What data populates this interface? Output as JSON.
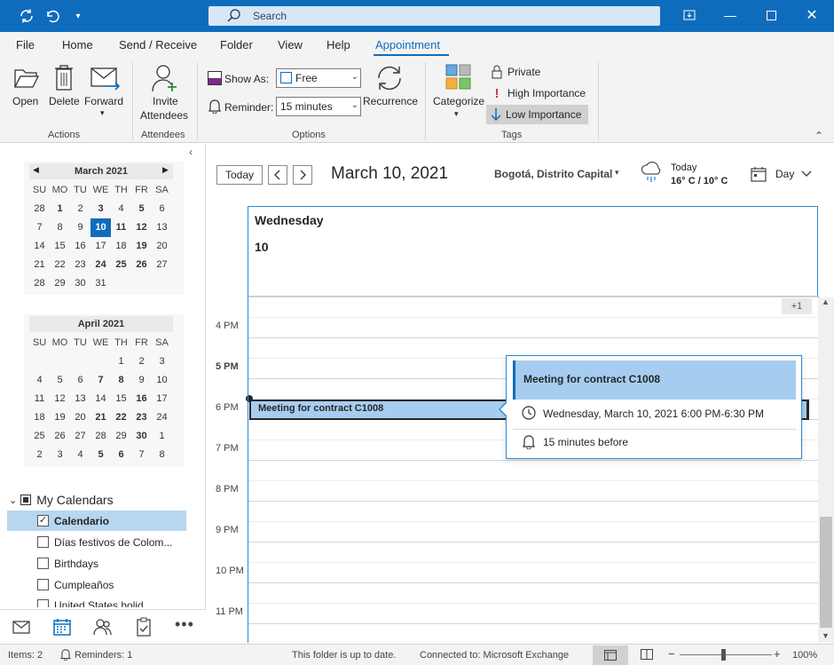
{
  "search": {
    "placeholder": "Search"
  },
  "menu": {
    "tabs": [
      {
        "label": "File"
      },
      {
        "label": "Home"
      },
      {
        "label": "Send / Receive"
      },
      {
        "label": "Folder"
      },
      {
        "label": "View"
      },
      {
        "label": "Help"
      },
      {
        "label": "Appointment",
        "active": true
      }
    ]
  },
  "ribbon": {
    "open": "Open",
    "delete": "Delete",
    "forward": "Forward",
    "invite_line1": "Invite",
    "invite_line2": "Attendees",
    "show_as_label": "Show As:",
    "show_as_value": "Free",
    "reminder_label": "Reminder:",
    "reminder_value": "15 minutes",
    "recurrence": "Recurrence",
    "categorize": "Categorize",
    "private": "Private",
    "high_importance": "High Importance",
    "low_importance": "Low Importance",
    "groups": {
      "actions": "Actions",
      "attendees": "Attendees",
      "options": "Options",
      "tags": "Tags"
    }
  },
  "minical": {
    "march": {
      "title": "March 2021",
      "weekdays": [
        "SU",
        "MO",
        "TU",
        "WE",
        "TH",
        "FR",
        "SA"
      ],
      "rows": [
        [
          "28",
          "1",
          "2",
          "3",
          "4",
          "5",
          "6"
        ],
        [
          "7",
          "8",
          "9",
          "10",
          "11",
          "12",
          "13"
        ],
        [
          "14",
          "15",
          "16",
          "17",
          "18",
          "19",
          "20"
        ],
        [
          "21",
          "22",
          "23",
          "24",
          "25",
          "26",
          "27"
        ],
        [
          "28",
          "29",
          "30",
          "31",
          "",
          "",
          ""
        ]
      ]
    },
    "april": {
      "title": "April 2021",
      "weekdays": [
        "SU",
        "MO",
        "TU",
        "WE",
        "TH",
        "FR",
        "SA"
      ],
      "rows": [
        [
          "",
          "",
          "",
          "",
          "1",
          "2",
          "3"
        ],
        [
          "4",
          "5",
          "6",
          "7",
          "8",
          "9",
          "10"
        ],
        [
          "11",
          "12",
          "13",
          "14",
          "15",
          "16",
          "17"
        ],
        [
          "18",
          "19",
          "20",
          "21",
          "22",
          "23",
          "24"
        ],
        [
          "25",
          "26",
          "27",
          "28",
          "29",
          "30",
          "1"
        ],
        [
          "2",
          "3",
          "4",
          "5",
          "6",
          "7",
          "8"
        ]
      ]
    }
  },
  "calendars": {
    "header": "My Calendars",
    "items": [
      {
        "label": "Calendario",
        "checked": true
      },
      {
        "label": "Días festivos de Colom...",
        "checked": false
      },
      {
        "label": "Birthdays",
        "checked": false
      },
      {
        "label": "Cumpleaños",
        "checked": false
      },
      {
        "label": "United States holid...",
        "checked": false
      }
    ]
  },
  "toolbar": {
    "today": "Today",
    "prev": "<",
    "next": ">",
    "date_title": "March 10, 2021",
    "location": "Bogotá, Distrito Capital",
    "weather_label": "Today",
    "weather_temp": "16° C / 10° C",
    "view": "Day"
  },
  "day": {
    "weekday": "Wednesday",
    "number": "10",
    "more_badge": "+1",
    "hours": [
      "4 PM",
      "5 PM",
      "6 PM",
      "7 PM",
      "8 PM",
      "9 PM",
      "10 PM",
      "11 PM"
    ]
  },
  "event": {
    "title": "Meeting for contract C1008"
  },
  "popup": {
    "title": "Meeting for contract C1008",
    "when": "Wednesday, March 10, 2021 6:00 PM-6:30 PM",
    "reminder": "15 minutes before"
  },
  "status": {
    "items": "Items: 2",
    "reminders": "Reminders: 1",
    "folder": "This folder is up to date.",
    "connection": "Connected to: Microsoft Exchange",
    "zoom": "100%"
  },
  "colors": {
    "accent": "#0f6cbd",
    "event": "#a6cdf0"
  }
}
